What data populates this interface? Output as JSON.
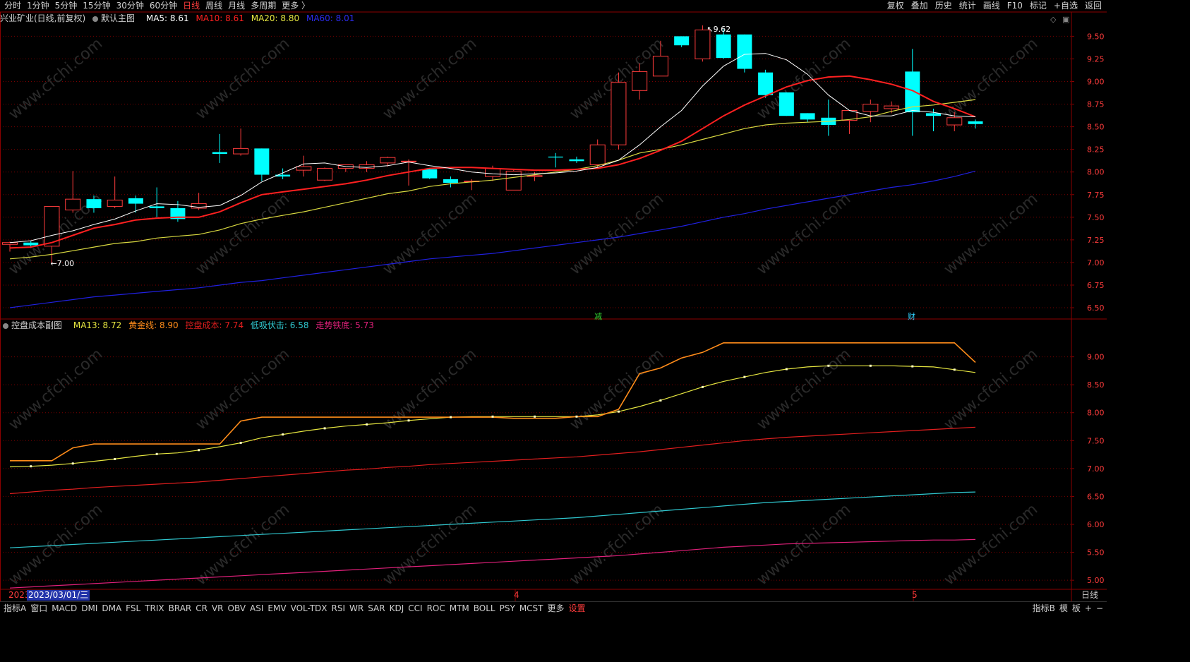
{
  "toolbar": {
    "periods": [
      "分时",
      "1分钟",
      "5分钟",
      "15分钟",
      "30分钟",
      "60分钟",
      "日线",
      "周线",
      "月线",
      "多周期",
      "更多 〉"
    ],
    "active_period": "日线",
    "right_tools": [
      "复权",
      "叠加",
      "历史",
      "统计",
      "画线",
      "F10",
      "标记",
      "+自选",
      "返回"
    ]
  },
  "main_panel": {
    "stock_title": "兴业矿业(日线,前复权)",
    "chart_name": "默认主图",
    "ma5": "MA5: 8.61",
    "ma10": "MA10: 8.61",
    "ma20": "MA20: 8.80",
    "ma60": "MA60: 8.01",
    "high_label": "9.62",
    "low_label": "←7.00",
    "marker_jian": "减",
    "marker_cai": "财",
    "y_ticks": [
      "9.50",
      "9.25",
      "9.00",
      "8.75",
      "8.50",
      "8.25",
      "8.00",
      "7.75",
      "7.50",
      "7.25",
      "7.00",
      "6.75",
      "6.50"
    ]
  },
  "sub_panel": {
    "title": "控盘成本副图",
    "ma13": "MA13: 8.72",
    "gold": "黄金线: 8.90",
    "cost": "控盘成本: 7.74",
    "low_buy": "低吸伏击: 6.58",
    "trend_bottom": "走势铁底: 5.73",
    "y_ticks": [
      "9.00",
      "8.50",
      "8.00",
      "7.50",
      "7.00",
      "6.50",
      "6.00",
      "5.50",
      "5.00"
    ]
  },
  "date_axis": {
    "year_label": "2023",
    "cursor_date": "2023/03/01/三",
    "month4": "4",
    "month5": "5",
    "period_label": "日线"
  },
  "indicators": [
    "指标A",
    "窗口",
    "MACD",
    "DMI",
    "DMA",
    "FSL",
    "TRIX",
    "BRAR",
    "CR",
    "VR",
    "OBV",
    "ASI",
    "EMV",
    "VOL-TDX",
    "RSI",
    "WR",
    "SAR",
    "KDJ",
    "CCI",
    "ROC",
    "MTM",
    "BOLL",
    "PSY",
    "MCST",
    "更多",
    "设置"
  ],
  "bottom_right": [
    "指标B",
    "模",
    "板",
    "+",
    "−"
  ],
  "watermark": "www.cfchi.com",
  "colors": {
    "up": "#ff3c3c",
    "down": "#00ffff",
    "ma5": "#ffffff",
    "ma10": "#ff2020",
    "ma20": "#d8d840",
    "ma60": "#2020e0",
    "gold": "#ff8c1a",
    "ma13": "#e6e640",
    "cost": "#e01e1e",
    "low_buy": "#30c8d0",
    "trend_bottom": "#e0207a"
  },
  "chart_data": {
    "type": "candlestick",
    "candles": [
      {
        "o": 7.2,
        "h": 7.23,
        "l": 7.12,
        "c": 7.22
      },
      {
        "o": 7.22,
        "h": 7.24,
        "l": 7.16,
        "c": 7.19
      },
      {
        "o": 7.18,
        "h": 7.38,
        "l": 7.0,
        "c": 7.62
      },
      {
        "o": 7.58,
        "h": 8.01,
        "l": 7.55,
        "c": 7.7
      },
      {
        "o": 7.7,
        "h": 7.74,
        "l": 7.55,
        "c": 7.6
      },
      {
        "o": 7.62,
        "h": 7.95,
        "l": 7.6,
        "c": 7.69
      },
      {
        "o": 7.71,
        "h": 7.74,
        "l": 7.55,
        "c": 7.65
      },
      {
        "o": 7.62,
        "h": 7.83,
        "l": 7.5,
        "c": 7.6
      },
      {
        "o": 7.6,
        "h": 7.68,
        "l": 7.45,
        "c": 7.48
      },
      {
        "o": 7.6,
        "h": 7.77,
        "l": 7.58,
        "c": 7.65
      },
      {
        "o": 8.22,
        "h": 8.42,
        "l": 8.1,
        "c": 8.2
      },
      {
        "o": 8.2,
        "h": 8.48,
        "l": 8.18,
        "c": 8.26
      },
      {
        "o": 8.26,
        "h": 8.26,
        "l": 7.9,
        "c": 7.97
      },
      {
        "o": 7.97,
        "h": 8.04,
        "l": 7.92,
        "c": 7.95
      },
      {
        "o": 8.02,
        "h": 8.18,
        "l": 7.95,
        "c": 8.06
      },
      {
        "o": 7.91,
        "h": 8.05,
        "l": 7.9,
        "c": 8.04
      },
      {
        "o": 8.04,
        "h": 8.08,
        "l": 8.0,
        "c": 8.08
      },
      {
        "o": 8.04,
        "h": 8.12,
        "l": 8.0,
        "c": 8.08
      },
      {
        "o": 8.1,
        "h": 8.17,
        "l": 8.06,
        "c": 8.16
      },
      {
        "o": 8.12,
        "h": 8.14,
        "l": 7.85,
        "c": 8.12
      },
      {
        "o": 8.03,
        "h": 8.04,
        "l": 7.92,
        "c": 7.93
      },
      {
        "o": 7.92,
        "h": 7.95,
        "l": 7.83,
        "c": 7.88
      },
      {
        "o": 7.9,
        "h": 7.92,
        "l": 7.8,
        "c": 7.9
      },
      {
        "o": 7.95,
        "h": 8.07,
        "l": 7.9,
        "c": 8.04
      },
      {
        "o": 7.8,
        "h": 8.03,
        "l": 7.8,
        "c": 8.01
      },
      {
        "o": 7.95,
        "h": 8.0,
        "l": 7.9,
        "c": 7.96
      },
      {
        "o": 8.17,
        "h": 8.21,
        "l": 8.05,
        "c": 8.16
      },
      {
        "o": 8.14,
        "h": 8.17,
        "l": 8.1,
        "c": 8.12
      },
      {
        "o": 8.08,
        "h": 8.36,
        "l": 8.05,
        "c": 8.3
      },
      {
        "o": 8.3,
        "h": 9.1,
        "l": 8.25,
        "c": 8.99
      },
      {
        "o": 8.9,
        "h": 9.2,
        "l": 8.8,
        "c": 9.11
      },
      {
        "o": 9.06,
        "h": 9.45,
        "l": 9.06,
        "c": 9.28
      },
      {
        "o": 9.5,
        "h": 9.5,
        "l": 9.38,
        "c": 9.4
      },
      {
        "o": 9.25,
        "h": 9.62,
        "l": 9.22,
        "c": 9.57
      },
      {
        "o": 9.52,
        "h": 9.58,
        "l": 9.25,
        "c": 9.26
      },
      {
        "o": 9.52,
        "h": 9.52,
        "l": 9.1,
        "c": 9.14
      },
      {
        "o": 9.1,
        "h": 9.13,
        "l": 8.82,
        "c": 8.85
      },
      {
        "o": 8.88,
        "h": 8.88,
        "l": 8.62,
        "c": 8.62
      },
      {
        "o": 8.65,
        "h": 8.65,
        "l": 8.55,
        "c": 8.58
      },
      {
        "o": 8.6,
        "h": 8.8,
        "l": 8.4,
        "c": 8.52
      },
      {
        "o": 8.57,
        "h": 8.68,
        "l": 8.42,
        "c": 8.68
      },
      {
        "o": 8.67,
        "h": 8.8,
        "l": 8.55,
        "c": 8.75
      },
      {
        "o": 8.7,
        "h": 8.78,
        "l": 8.65,
        "c": 8.73
      },
      {
        "o": 9.11,
        "h": 9.36,
        "l": 8.4,
        "c": 8.66
      },
      {
        "o": 8.65,
        "h": 8.7,
        "l": 8.45,
        "c": 8.62
      },
      {
        "o": 8.52,
        "h": 8.66,
        "l": 8.45,
        "c": 8.6
      },
      {
        "o": 8.56,
        "h": 8.58,
        "l": 8.48,
        "c": 8.53
      }
    ],
    "ma5": [
      7.22,
      7.24,
      7.3,
      7.35,
      7.42,
      7.48,
      7.57,
      7.65,
      7.64,
      7.61,
      7.63,
      7.74,
      7.89,
      7.99,
      8.09,
      8.1,
      8.06,
      8.05,
      8.07,
      8.11,
      8.07,
      8.04,
      8.0,
      7.98,
      7.97,
      7.98,
      7.99,
      8.01,
      8.05,
      8.13,
      8.3,
      8.5,
      8.68,
      8.95,
      9.17,
      9.3,
      9.31,
      9.24,
      9.08,
      8.85,
      8.68,
      8.62,
      8.62,
      8.68,
      8.66,
      8.62,
      8.61
    ],
    "ma10": [
      7.16,
      7.17,
      7.22,
      7.3,
      7.38,
      7.42,
      7.47,
      7.49,
      7.5,
      7.5,
      7.56,
      7.66,
      7.75,
      7.78,
      7.81,
      7.84,
      7.87,
      7.91,
      7.96,
      8.0,
      8.04,
      8.05,
      8.05,
      8.04,
      8.03,
      8.02,
      8.02,
      8.03,
      8.04,
      8.08,
      8.15,
      8.24,
      8.34,
      8.48,
      8.62,
      8.74,
      8.84,
      8.94,
      9.01,
      9.05,
      9.06,
      9.02,
      8.97,
      8.9,
      8.78,
      8.7,
      8.61
    ],
    "ma20": [
      7.04,
      7.06,
      7.09,
      7.13,
      7.17,
      7.21,
      7.23,
      7.27,
      7.29,
      7.31,
      7.36,
      7.43,
      7.48,
      7.52,
      7.56,
      7.61,
      7.66,
      7.71,
      7.76,
      7.79,
      7.84,
      7.87,
      7.89,
      7.91,
      7.94,
      7.97,
      8.0,
      8.03,
      8.07,
      8.13,
      8.21,
      8.25,
      8.3,
      8.36,
      8.42,
      8.48,
      8.52,
      8.54,
      8.55,
      8.56,
      8.58,
      8.61,
      8.67,
      8.72,
      8.74,
      8.77,
      8.8
    ],
    "ma60": [
      6.5,
      6.53,
      6.56,
      6.59,
      6.62,
      6.64,
      6.66,
      6.68,
      6.7,
      6.72,
      6.75,
      6.78,
      6.8,
      6.83,
      6.86,
      6.89,
      6.92,
      6.95,
      6.98,
      7.01,
      7.04,
      7.06,
      7.08,
      7.1,
      7.13,
      7.16,
      7.19,
      7.22,
      7.25,
      7.28,
      7.32,
      7.36,
      7.4,
      7.45,
      7.5,
      7.54,
      7.59,
      7.63,
      7.67,
      7.71,
      7.75,
      7.79,
      7.83,
      7.86,
      7.9,
      7.95,
      8.01
    ],
    "sub": {
      "ma13": [
        7.03,
        7.04,
        7.06,
        7.09,
        7.13,
        7.17,
        7.22,
        7.26,
        7.28,
        7.33,
        7.39,
        7.46,
        7.55,
        7.61,
        7.67,
        7.72,
        7.76,
        7.79,
        7.82,
        7.86,
        7.89,
        7.92,
        7.93,
        7.93,
        7.93,
        7.93,
        7.93,
        7.93,
        7.96,
        8.02,
        8.11,
        8.22,
        8.34,
        8.46,
        8.56,
        8.64,
        8.72,
        8.78,
        8.82,
        8.84,
        8.84,
        8.84,
        8.84,
        8.83,
        8.82,
        8.77,
        8.72
      ],
      "gold": [
        7.14,
        7.14,
        7.14,
        7.37,
        7.44,
        7.44,
        7.44,
        7.44,
        7.44,
        7.44,
        7.44,
        7.85,
        7.92,
        7.92,
        7.92,
        7.92,
        7.92,
        7.92,
        7.92,
        7.92,
        7.92,
        7.92,
        7.92,
        7.92,
        7.9,
        7.9,
        7.9,
        7.93,
        7.93,
        8.06,
        8.7,
        8.8,
        8.98,
        9.08,
        9.25,
        9.25,
        9.25,
        9.25,
        9.25,
        9.25,
        9.25,
        9.25,
        9.25,
        9.25,
        9.25,
        9.25,
        8.9
      ],
      "cost": [
        6.55,
        6.58,
        6.61,
        6.63,
        6.66,
        6.68,
        6.7,
        6.72,
        6.74,
        6.76,
        6.79,
        6.82,
        6.85,
        6.88,
        6.91,
        6.94,
        6.97,
        6.99,
        7.02,
        7.04,
        7.07,
        7.09,
        7.11,
        7.13,
        7.15,
        7.17,
        7.19,
        7.21,
        7.24,
        7.27,
        7.3,
        7.34,
        7.38,
        7.42,
        7.46,
        7.5,
        7.53,
        7.56,
        7.58,
        7.6,
        7.62,
        7.64,
        7.66,
        7.68,
        7.7,
        7.72,
        7.74
      ],
      "low_buy": [
        5.58,
        5.6,
        5.62,
        5.64,
        5.66,
        5.68,
        5.7,
        5.72,
        5.74,
        5.76,
        5.78,
        5.8,
        5.82,
        5.84,
        5.86,
        5.88,
        5.9,
        5.92,
        5.94,
        5.96,
        5.98,
        6.0,
        6.02,
        6.04,
        6.06,
        6.08,
        6.1,
        6.12,
        6.15,
        6.18,
        6.21,
        6.24,
        6.27,
        6.3,
        6.33,
        6.36,
        6.39,
        6.41,
        6.43,
        6.45,
        6.47,
        6.49,
        6.51,
        6.53,
        6.55,
        6.57,
        6.58
      ],
      "trend_bottom": [
        4.86,
        4.88,
        4.9,
        4.92,
        4.94,
        4.96,
        4.98,
        5.0,
        5.02,
        5.04,
        5.06,
        5.08,
        5.1,
        5.12,
        5.14,
        5.16,
        5.18,
        5.2,
        5.22,
        5.24,
        5.26,
        5.28,
        5.3,
        5.32,
        5.34,
        5.36,
        5.38,
        5.4,
        5.42,
        5.44,
        5.47,
        5.5,
        5.53,
        5.56,
        5.59,
        5.61,
        5.63,
        5.65,
        5.66,
        5.67,
        5.68,
        5.69,
        5.7,
        5.71,
        5.72,
        5.72,
        5.73
      ]
    },
    "main_ylim": [
      6.43,
      9.62
    ],
    "sub_ylim": [
      4.85,
      9.45
    ]
  }
}
